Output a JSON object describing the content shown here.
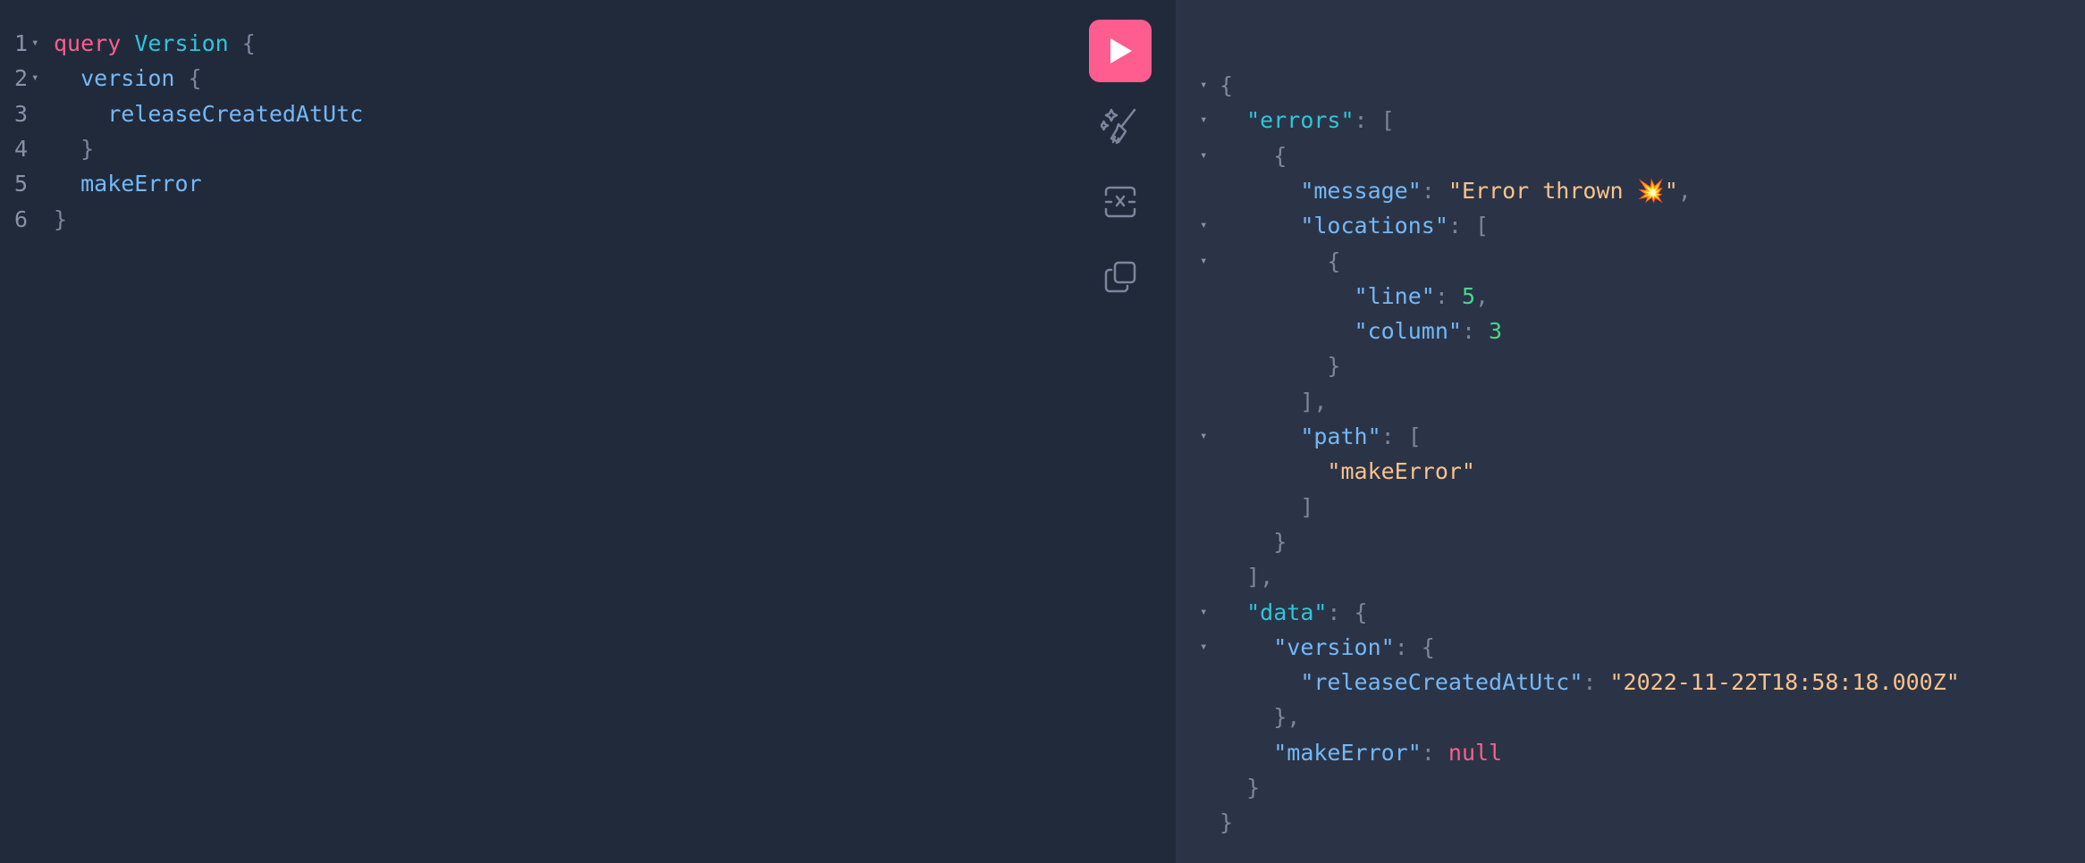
{
  "editor": {
    "line_numbers": [
      "1",
      "2",
      "3",
      "4",
      "5",
      "6"
    ],
    "lines": [
      [
        {
          "t": "query",
          "c": "kw"
        },
        {
          "t": " ",
          "c": "pn"
        },
        {
          "t": "Version",
          "c": "tn"
        },
        {
          "t": " {",
          "c": "pn"
        }
      ],
      [
        {
          "t": "  version",
          "c": "fd"
        },
        {
          "t": " {",
          "c": "pn"
        }
      ],
      [
        {
          "t": "    releaseCreatedAtUtc",
          "c": "fd"
        }
      ],
      [
        {
          "t": "  }",
          "c": "pn"
        }
      ],
      [
        {
          "t": "  makeError",
          "c": "fd"
        }
      ],
      [
        {
          "t": "}",
          "c": "pn"
        }
      ]
    ],
    "fold_markers": [
      "▾",
      "▾"
    ]
  },
  "toolbar": {
    "run_icon": "play-icon",
    "prettify_icon": "magic-wand-brush-icon",
    "merge_icon": "merge-fragments-icon",
    "copy_icon": "copy-icon"
  },
  "response": {
    "lines": [
      [
        {
          "t": "{",
          "c": "pn"
        }
      ],
      [
        {
          "t": "  ",
          "c": "pn"
        },
        {
          "t": "\"errors\"",
          "c": "key-t"
        },
        {
          "t": ": [",
          "c": "pn"
        }
      ],
      [
        {
          "t": "    {",
          "c": "pn"
        }
      ],
      [
        {
          "t": "      ",
          "c": "pn"
        },
        {
          "t": "\"message\"",
          "c": "key"
        },
        {
          "t": ": ",
          "c": "pn"
        },
        {
          "t": "\"Error thrown 💥\"",
          "c": "str"
        },
        {
          "t": ",",
          "c": "pn"
        }
      ],
      [
        {
          "t": "      ",
          "c": "pn"
        },
        {
          "t": "\"locations\"",
          "c": "key"
        },
        {
          "t": ": [",
          "c": "pn"
        }
      ],
      [
        {
          "t": "        {",
          "c": "pn"
        }
      ],
      [
        {
          "t": "          ",
          "c": "pn"
        },
        {
          "t": "\"line\"",
          "c": "key"
        },
        {
          "t": ": ",
          "c": "pn"
        },
        {
          "t": "5",
          "c": "num"
        },
        {
          "t": ",",
          "c": "pn"
        }
      ],
      [
        {
          "t": "          ",
          "c": "pn"
        },
        {
          "t": "\"column\"",
          "c": "key"
        },
        {
          "t": ": ",
          "c": "pn"
        },
        {
          "t": "3",
          "c": "num"
        }
      ],
      [
        {
          "t": "        }",
          "c": "pn"
        }
      ],
      [
        {
          "t": "      ],",
          "c": "pn"
        }
      ],
      [
        {
          "t": "      ",
          "c": "pn"
        },
        {
          "t": "\"path\"",
          "c": "key"
        },
        {
          "t": ": [",
          "c": "pn"
        }
      ],
      [
        {
          "t": "        ",
          "c": "pn"
        },
        {
          "t": "\"makeError\"",
          "c": "str"
        }
      ],
      [
        {
          "t": "      ]",
          "c": "pn"
        }
      ],
      [
        {
          "t": "    }",
          "c": "pn"
        }
      ],
      [
        {
          "t": "  ],",
          "c": "pn"
        }
      ],
      [
        {
          "t": "  ",
          "c": "pn"
        },
        {
          "t": "\"data\"",
          "c": "key-t"
        },
        {
          "t": ": {",
          "c": "pn"
        }
      ],
      [
        {
          "t": "    ",
          "c": "pn"
        },
        {
          "t": "\"version\"",
          "c": "key"
        },
        {
          "t": ": {",
          "c": "pn"
        }
      ],
      [
        {
          "t": "      ",
          "c": "pn"
        },
        {
          "t": "\"releaseCreatedAtUtc\"",
          "c": "key"
        },
        {
          "t": ": ",
          "c": "pn"
        },
        {
          "t": "\"2022-11-22T18:58:18.000Z\"",
          "c": "str"
        }
      ],
      [
        {
          "t": "    },",
          "c": "pn"
        }
      ],
      [
        {
          "t": "    ",
          "c": "pn"
        },
        {
          "t": "\"makeError\"",
          "c": "key"
        },
        {
          "t": ": ",
          "c": "pn"
        },
        {
          "t": "null",
          "c": "null"
        }
      ],
      [
        {
          "t": "  }",
          "c": "pn"
        }
      ],
      [
        {
          "t": "}",
          "c": "pn"
        }
      ]
    ],
    "fold_markers": [
      "▾",
      "▾",
      "▾",
      "▾",
      "▾",
      "▾",
      "▾",
      "▾"
    ]
  },
  "colors": {
    "editor_bg": "#212a3b",
    "response_bg": "#2b3446",
    "accent": "#ff5d8f"
  }
}
